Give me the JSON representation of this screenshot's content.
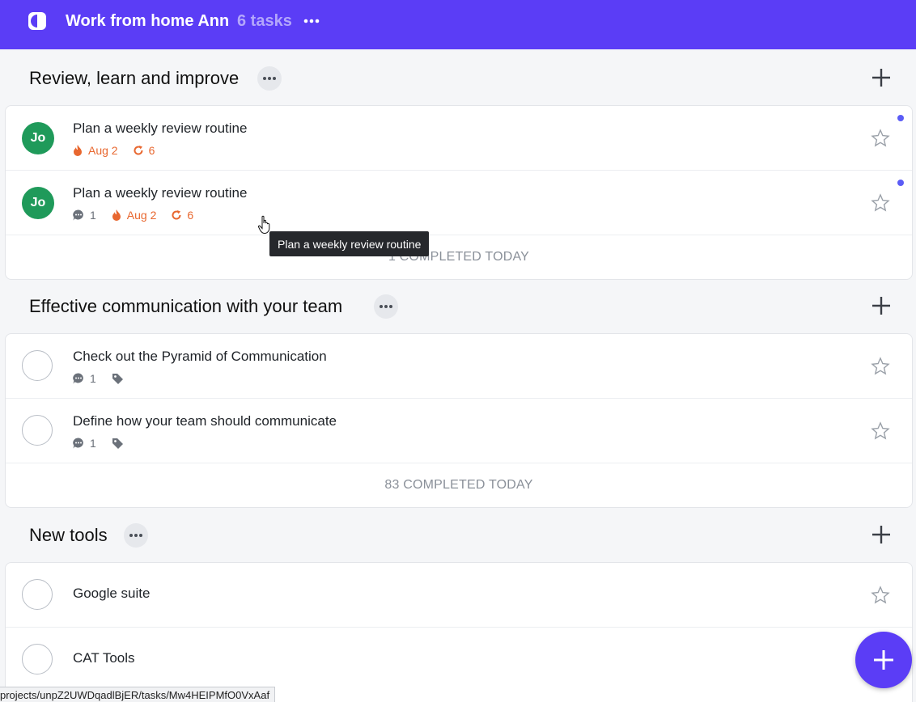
{
  "header": {
    "title": "Work from home Ann",
    "task_count": "6 tasks"
  },
  "sections": [
    {
      "name": "Review, learn and improve",
      "tasks": [
        {
          "avatar": "Jo",
          "title": "Plan a weekly review routine",
          "due": "Aug 2",
          "recurrence": "6"
        },
        {
          "avatar": "Jo",
          "title": "Plan a weekly review routine",
          "comments": "1",
          "due": "Aug 2",
          "recurrence": "6"
        }
      ],
      "completed": "1 COMPLETED TODAY"
    },
    {
      "name": "Effective communication with your team",
      "tasks": [
        {
          "title": "Check out the Pyramid of Communication",
          "comments": "1"
        },
        {
          "title": "Define how your team should communicate",
          "comments": "1"
        }
      ],
      "completed": "83 COMPLETED TODAY"
    },
    {
      "name": "New tools",
      "tasks": [
        {
          "title": "Google suite"
        },
        {
          "title": "CAT Tools"
        }
      ]
    }
  ],
  "tooltip": "Plan a weekly review routine",
  "status_url": "projects/unpZ2UWDqadlBjER/tasks/Mw4HEIPMfO0VxAaf",
  "icons": {
    "logo": "app-logo-icon",
    "more": "more-dots-icon",
    "add": "plus-icon",
    "star": "star-icon",
    "comment": "comment-icon",
    "due": "fire-icon",
    "recurrence": "repeat-icon",
    "tag": "tag-icon"
  },
  "colors": {
    "brand": "#5b3df6",
    "avatar": "#1f9a5a",
    "due": "#e8672f",
    "unread_dot": "#5b5cf6"
  }
}
